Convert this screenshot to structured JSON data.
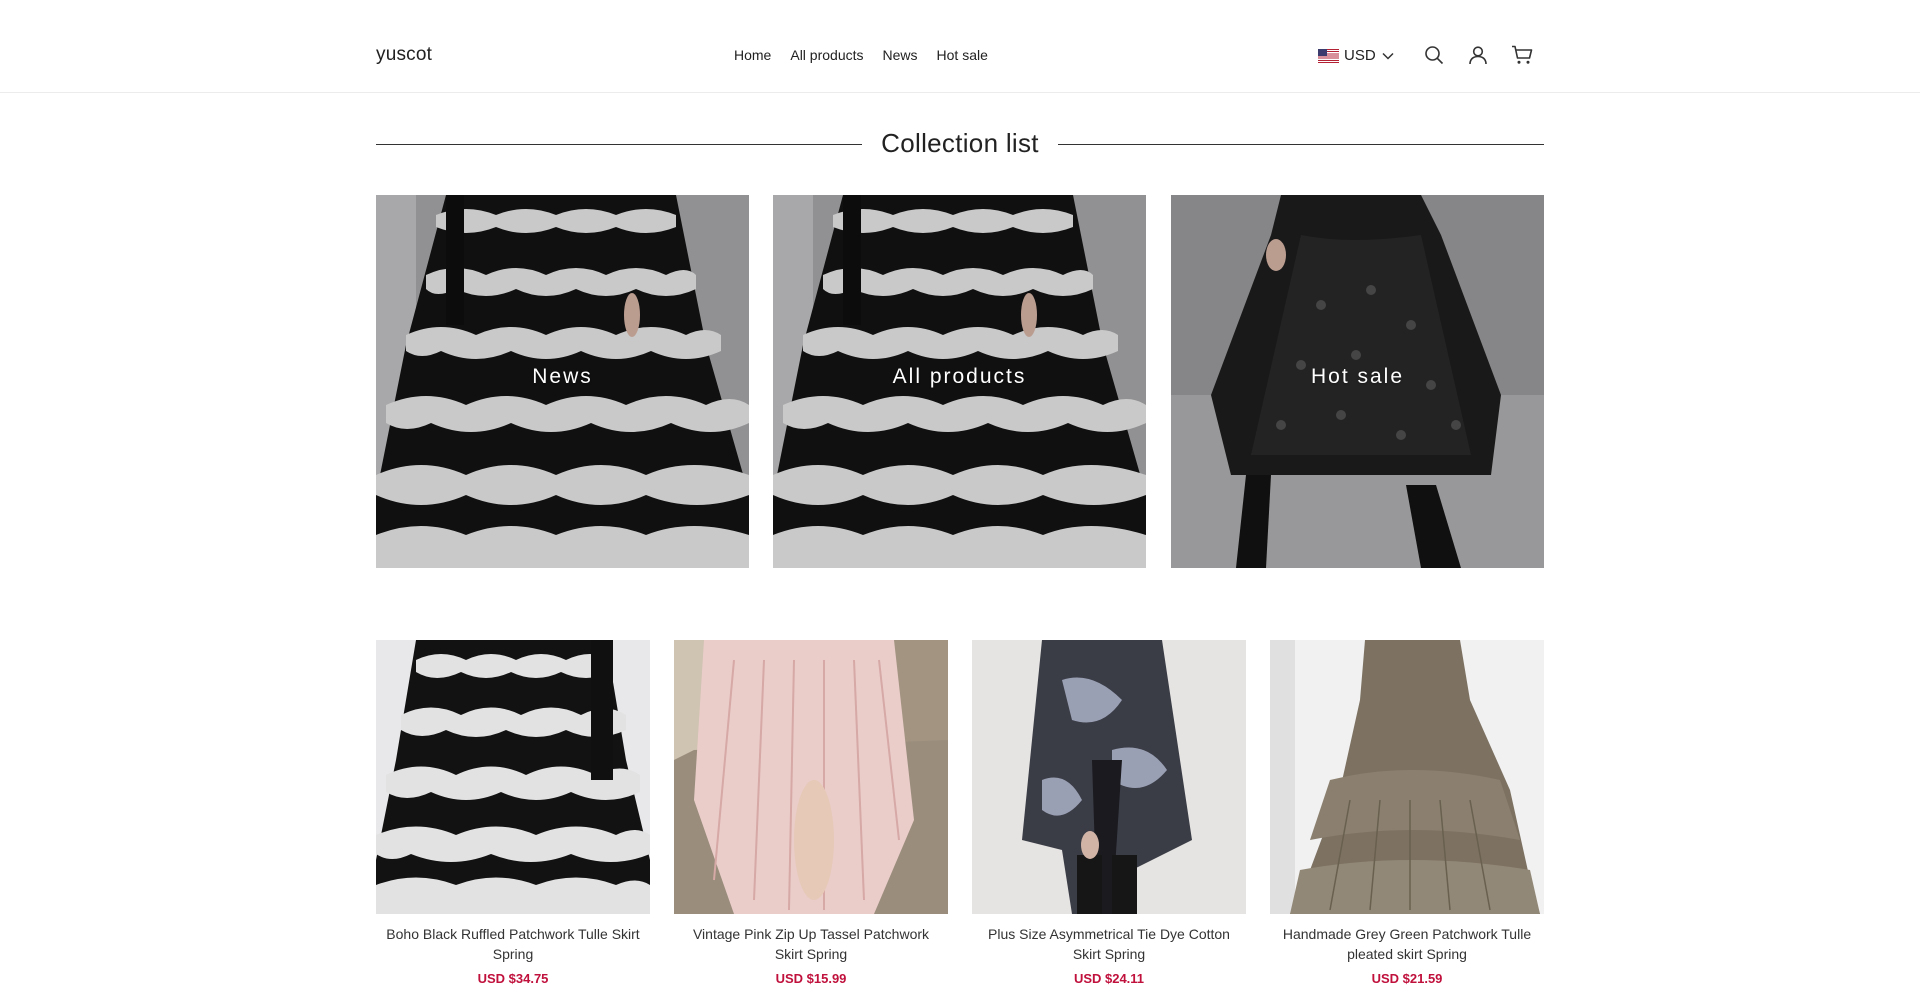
{
  "header": {
    "logo": "yuscot",
    "nav": [
      "Home",
      "All products",
      "News",
      "Hot sale"
    ],
    "currency": "USD"
  },
  "collection": {
    "title": "Collection list",
    "items": [
      {
        "label": "News"
      },
      {
        "label": "All products"
      },
      {
        "label": "Hot sale"
      }
    ]
  },
  "products": [
    {
      "title": "Boho Black Ruffled Patchwork Tulle Skirt Spring",
      "price": "USD $34.75"
    },
    {
      "title": "Vintage Pink Zip Up Tassel Patchwork Skirt Spring",
      "price": "USD $15.99"
    },
    {
      "title": "Plus Size Asymmetrical Tie Dye Cotton Skirt Spring",
      "price": "USD $24.11"
    },
    {
      "title": "Handmade Grey Green Patchwork Tulle pleated skirt Spring",
      "price": "USD $21.59"
    }
  ],
  "colors": {
    "price": "#c0103c",
    "text": "#222222",
    "divider": "#333333"
  },
  "icons": [
    "us-flag-icon",
    "chevron-down-icon",
    "search-icon",
    "account-icon",
    "cart-icon"
  ]
}
